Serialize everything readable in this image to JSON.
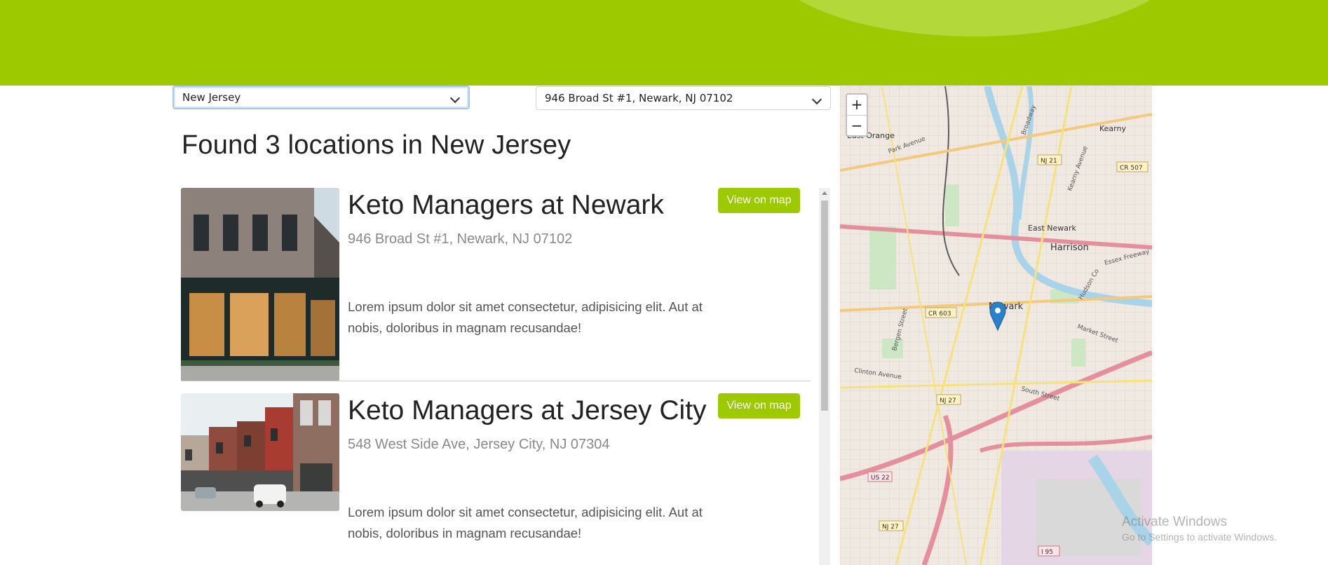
{
  "filters": {
    "state_value": "New Jersey",
    "location_value": "946 Broad St #1, Newark, NJ 07102"
  },
  "results_heading": "Found 3 locations in New Jersey",
  "locations": [
    {
      "name": "Keto Managers at Newark",
      "address": "946 Broad St #1, Newark, NJ 07102",
      "description": "Lorem ipsum dolor sit amet consectetur, adipisicing elit. Aut at nobis, doloribus in magnam recusandae!",
      "button": "View on map"
    },
    {
      "name": "Keto Managers at Jersey City",
      "address": "548 West Side Ave, Jersey City, NJ 07304",
      "description": "Lorem ipsum dolor sit amet consectetur, adipisicing elit. Aut at nobis, doloribus in magnam recusandae!",
      "button": "View on map"
    }
  ],
  "map": {
    "zoom_in": "+",
    "zoom_out": "−",
    "labels": {
      "east_orange": "East Orange",
      "kearny": "Kearny",
      "east_newark": "East Newark",
      "harrison": "Harrison",
      "newark": "Newark",
      "nj21": "NJ 21",
      "cr507": "CR 507",
      "cr603": "CR 603",
      "nj27a": "NJ 27",
      "nj27b": "NJ 27",
      "us22": "US 22",
      "i95": "I 95",
      "park_ave": "Park Avenue",
      "broadway": "Broadway",
      "essex_fwy": "Essex Freeway",
      "market_st": "Market Street",
      "south_st": "South Street",
      "clinton_ave": "Clinton Avenue",
      "bergen_st": "Bergen Street",
      "hudson": "Hudson Co",
      "kearny_ave": "Kearny Avenue"
    }
  },
  "watermark": {
    "line1": "Activate Windows",
    "line2": "Go to Settings to activate Windows."
  }
}
